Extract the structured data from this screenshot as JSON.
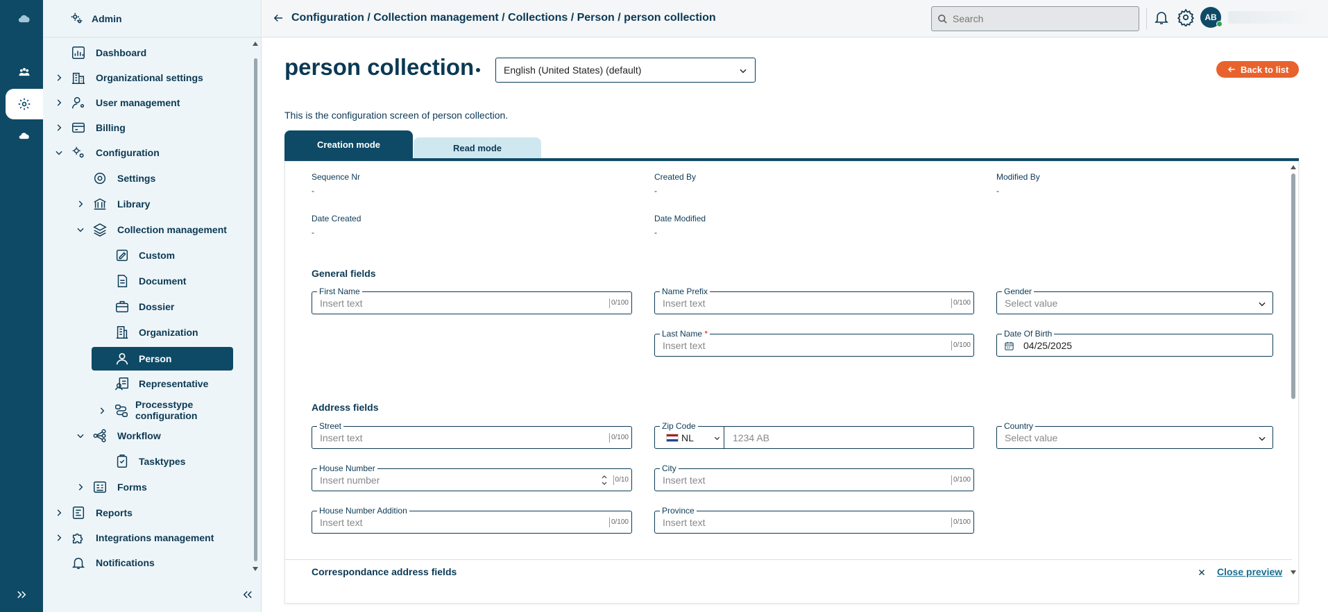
{
  "sidebar": {
    "header": "Admin",
    "items": [
      {
        "label": "Dashboard"
      },
      {
        "label": "Organizational settings"
      },
      {
        "label": "User management"
      },
      {
        "label": "Billing"
      },
      {
        "label": "Configuration"
      },
      {
        "label": "Settings"
      },
      {
        "label": "Library"
      },
      {
        "label": "Collection management"
      },
      {
        "label": "Custom"
      },
      {
        "label": "Document"
      },
      {
        "label": "Dossier"
      },
      {
        "label": "Organization"
      },
      {
        "label": "Person"
      },
      {
        "label": "Representative"
      },
      {
        "label": "Processtype configuration"
      },
      {
        "label": "Workflow"
      },
      {
        "label": "Tasktypes"
      },
      {
        "label": "Forms"
      },
      {
        "label": "Reports"
      },
      {
        "label": "Integrations management"
      },
      {
        "label": "Notifications"
      }
    ]
  },
  "topbar": {
    "breadcrumb": "Configuration / Collection management / Collections / Person / person collection",
    "search_placeholder": "Search",
    "avatar_initials": "AB"
  },
  "main": {
    "title": "person collection",
    "language": "English (United States) (default)",
    "back_label": "Back to list",
    "description": "This is the configuration screen of person collection.",
    "tabs": [
      {
        "label": "Creation mode"
      },
      {
        "label": "Read mode"
      }
    ],
    "meta": [
      {
        "label": "Sequence Nr",
        "value": "-"
      },
      {
        "label": "Created By",
        "value": "-"
      },
      {
        "label": "Modified By",
        "value": "-"
      },
      {
        "label": "Date Created",
        "value": "-"
      },
      {
        "label": "Date Modified",
        "value": "-"
      }
    ],
    "general_title": "General fields",
    "address_title": "Address fields",
    "correspondance_title": "Correspondance address fields",
    "close_preview": "Close preview",
    "fields": {
      "first_name": {
        "label": "First Name",
        "placeholder": "Insert text",
        "count": "0/100"
      },
      "name_prefix": {
        "label": "Name Prefix",
        "placeholder": "Insert text",
        "count": "0/100"
      },
      "gender": {
        "label": "Gender",
        "placeholder": "Select value"
      },
      "last_name": {
        "label": "Last Name",
        "required": "*",
        "placeholder": "Insert text",
        "count": "0/100"
      },
      "dob": {
        "label": "Date Of Birth",
        "value": "04/25/2025"
      },
      "street": {
        "label": "Street",
        "placeholder": "Insert text",
        "count": "0/100"
      },
      "zip": {
        "label": "Zip Code",
        "country": "NL",
        "placeholder": "1234 AB"
      },
      "country": {
        "label": "Country",
        "placeholder": "Select value"
      },
      "house_number": {
        "label": "House Number",
        "placeholder": "Insert number",
        "count": "0/10"
      },
      "city": {
        "label": "City",
        "placeholder": "Insert text",
        "count": "0/100"
      },
      "house_number_addition": {
        "label": "House Number Addition",
        "placeholder": "Insert text",
        "count": "0/100"
      },
      "province": {
        "label": "Province",
        "placeholder": "Insert text",
        "count": "0/100"
      }
    }
  },
  "colors": {
    "primary": "#0e4a66",
    "accent": "#e8622d",
    "tab_inactive": "#cfe8ef",
    "sidebar_bg": "#eef5f8"
  }
}
